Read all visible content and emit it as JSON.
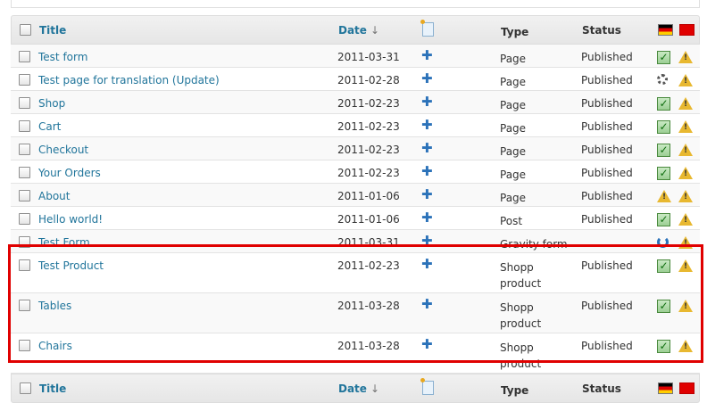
{
  "columns": {
    "title": "Title",
    "date": "Date",
    "sort_arrow": "↓",
    "type": "Type",
    "status": "Status"
  },
  "icons": {
    "new_doc": "new-document-icon",
    "flag_1": "german-flag-icon",
    "flag_2": "chinese-flag-icon",
    "add": "plus-icon",
    "ok": "check-icon",
    "warn": "warning-icon",
    "busy": "spinner-icon",
    "sync": "refresh-icon"
  },
  "colors": {
    "link": "#21759b",
    "highlight": "#e00000",
    "add": "#2b72b9"
  },
  "rows": [
    {
      "title": "Test form",
      "date": "2011-03-31",
      "plus": "✚",
      "type1": "Page",
      "type2": "",
      "status": "Published",
      "de": "check",
      "cn": "warn"
    },
    {
      "title": "Test page for translation (Update)",
      "date": "2011-02-28",
      "plus": "✚",
      "type1": "Page",
      "type2": "",
      "status": "Published",
      "de": "spinner",
      "cn": "warn"
    },
    {
      "title": "Shop",
      "date": "2011-02-23",
      "plus": "✚",
      "type1": "Page",
      "type2": "",
      "status": "Published",
      "de": "check",
      "cn": "warn"
    },
    {
      "title": "Cart",
      "date": "2011-02-23",
      "plus": "✚",
      "type1": "Page",
      "type2": "",
      "status": "Published",
      "de": "check",
      "cn": "warn"
    },
    {
      "title": "Checkout",
      "date": "2011-02-23",
      "plus": "✚",
      "type1": "Page",
      "type2": "",
      "status": "Published",
      "de": "check",
      "cn": "warn"
    },
    {
      "title": "Your Orders",
      "date": "2011-02-23",
      "plus": "✚",
      "type1": "Page",
      "type2": "",
      "status": "Published",
      "de": "check",
      "cn": "warn"
    },
    {
      "title": "About",
      "date": "2011-01-06",
      "plus": "✚",
      "type1": "Page",
      "type2": "",
      "status": "Published",
      "de": "warn",
      "cn": "warn"
    },
    {
      "title": "Hello world!",
      "date": "2011-01-06",
      "plus": "✚",
      "type1": "Post",
      "type2": "",
      "status": "Published",
      "de": "check",
      "cn": "warn"
    },
    {
      "title": "Test Form",
      "date": "2011-03-31",
      "plus": "✚",
      "type1": "Gravity form",
      "type2": "",
      "status": "",
      "de": "refresh",
      "cn": "warn"
    },
    {
      "title": "Test Product",
      "date": "2011-02-23",
      "plus": "✚",
      "type1": "Shopp",
      "type2": "product",
      "status": "Published",
      "de": "check",
      "cn": "warn"
    },
    {
      "title": "Tables",
      "date": "2011-03-28",
      "plus": "✚",
      "type1": "Shopp",
      "type2": "product",
      "status": "Published",
      "de": "check",
      "cn": "warn"
    },
    {
      "title": "Chairs",
      "date": "2011-03-28",
      "plus": "✚",
      "type1": "Shopp",
      "type2": "product",
      "status": "Published",
      "de": "check",
      "cn": "warn"
    }
  ]
}
